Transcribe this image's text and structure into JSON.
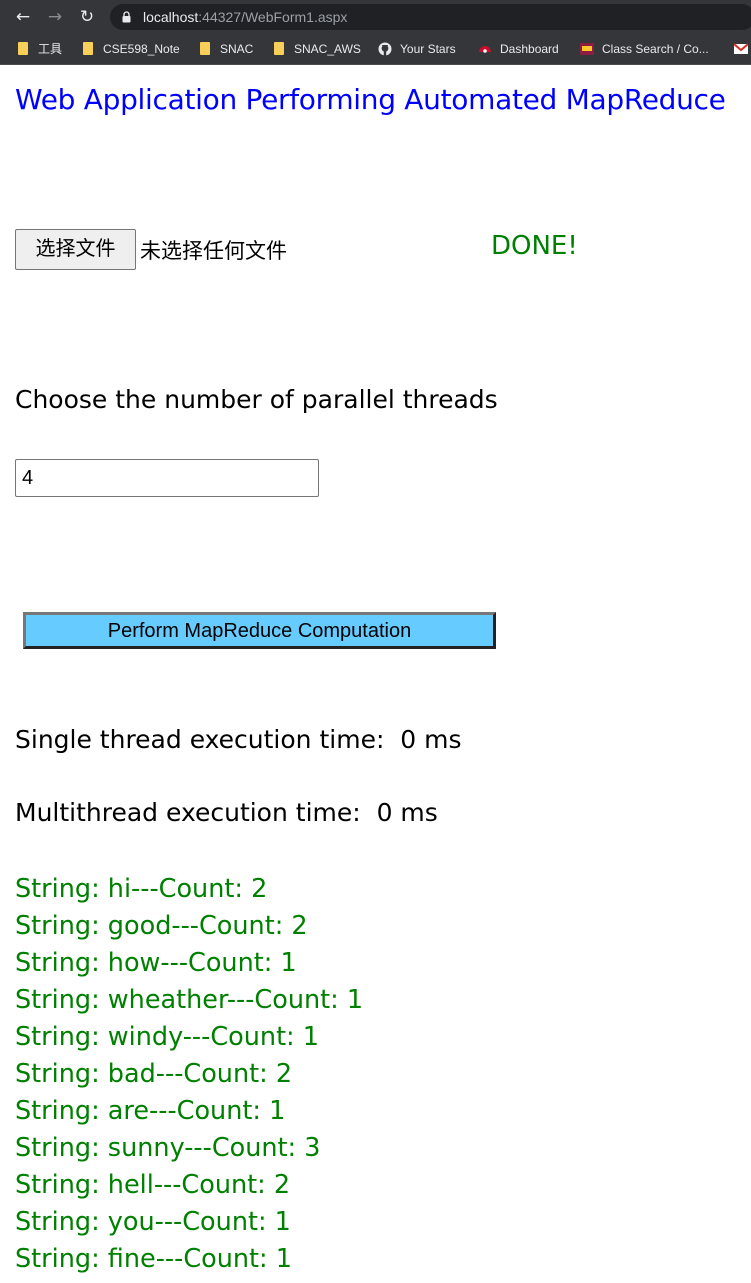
{
  "browser": {
    "url_host": "localhost",
    "url_rest": ":44327/WebForm1.aspx",
    "bookmarks": [
      {
        "label": "工具",
        "icon": "folder-icon"
      },
      {
        "label": "CSE598_Note",
        "icon": "folder-icon"
      },
      {
        "label": "SNAC",
        "icon": "folder-icon"
      },
      {
        "label": "SNAC_AWS",
        "icon": "folder-icon"
      },
      {
        "label": "Your Stars",
        "icon": "github-icon"
      },
      {
        "label": "Dashboard",
        "icon": "dashboard-icon"
      },
      {
        "label": "Class Search / Co...",
        "icon": "asu-icon"
      }
    ]
  },
  "page": {
    "title": "Web Application Performing Automated MapReduce",
    "file_button_label": "选择文件",
    "file_status": "未选择任何文件",
    "done_text": "DONE!",
    "threads_label": "Choose the number of parallel threads",
    "threads_value": "4",
    "run_button_label": "Perform MapReduce Computation",
    "single_time": "Single thread execution time:  0 ms",
    "multi_time": "Multithread execution time:  0 ms",
    "results": [
      "String: hi---Count: 2",
      "String: good---Count: 2",
      "String: how---Count: 1",
      "String: wheather---Count: 1",
      "String: windy---Count: 1",
      "String: bad---Count: 2",
      "String: are---Count: 1",
      "String: sunny---Count: 3",
      "String: hell---Count: 2",
      "String: you---Count: 1",
      "String: fine---Count: 1"
    ]
  },
  "colors": {
    "title": "#0000ff",
    "done": "#008000",
    "results": "#008000",
    "run_button_bg": "#66ccff"
  }
}
